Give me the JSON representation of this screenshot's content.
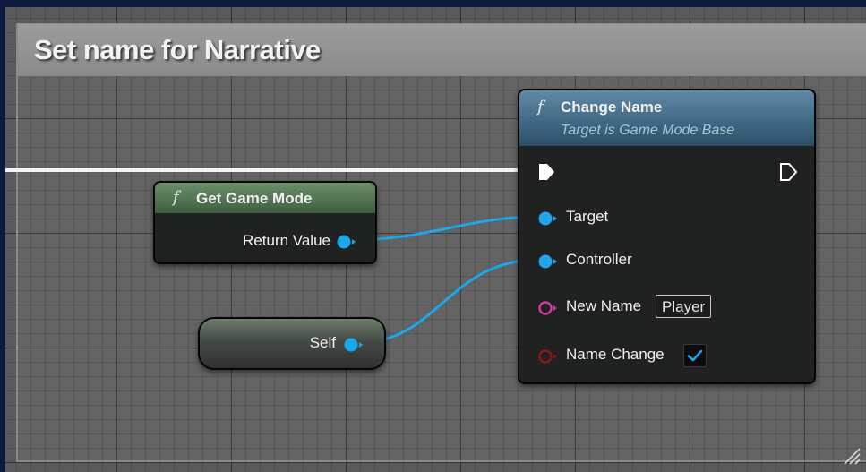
{
  "comment": {
    "title": "Set name for Narrative"
  },
  "nodes": {
    "get_game_mode": {
      "title": "Get Game Mode",
      "output_label": "Return Value"
    },
    "self": {
      "label": "Self"
    },
    "change_name": {
      "title": "Change Name",
      "subtitle": "Target is Game Mode Base",
      "pins": {
        "target": "Target",
        "controller": "Controller",
        "new_name": "New Name",
        "name_change": "Name Change"
      },
      "new_name_value": "Player",
      "name_change_checked": true
    }
  },
  "icons": {
    "function": "f",
    "check": "checkmark-icon"
  },
  "colors": {
    "object_pin": "#1aa7ec",
    "string_pin": "#d0379f",
    "bool_pin": "#8b1717",
    "exec_wire": "#ffffff",
    "pure_header": "#4f7a4f",
    "function_header": "#3c6a88"
  }
}
